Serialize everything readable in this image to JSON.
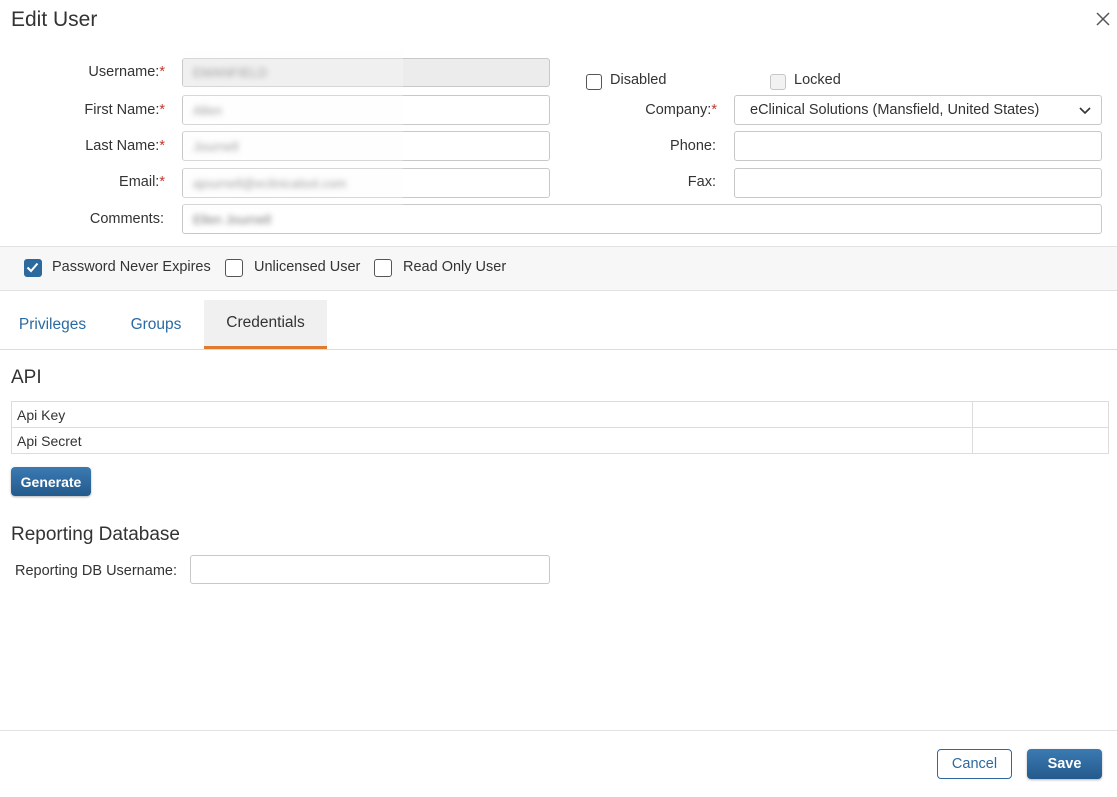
{
  "dialog": {
    "title": "Edit User",
    "close_icon": "close-icon"
  },
  "form": {
    "username": {
      "label": "Username:",
      "required": "*",
      "value": "EMANFIELD"
    },
    "first_name": {
      "label": "First Name:",
      "required": "*",
      "value": "Allen"
    },
    "last_name": {
      "label": "Last Name:",
      "required": "*",
      "value": "Journell"
    },
    "email": {
      "label": "Email:",
      "required": "*",
      "value": "ajournell@eclinicalsol.com"
    },
    "comments": {
      "label": "Comments:",
      "value": "Ellen Journell"
    },
    "disabled": {
      "label": "Disabled",
      "checked": false
    },
    "locked": {
      "label": "Locked",
      "checked": false,
      "disabled": true
    },
    "company": {
      "label": "Company:",
      "required": "*",
      "value": "eClinical Solutions (Mansfield, United States)"
    },
    "phone": {
      "label": "Phone:",
      "value": ""
    },
    "fax": {
      "label": "Fax:",
      "value": ""
    }
  },
  "options": {
    "password_never_expires": {
      "label": "Password Never Expires",
      "checked": true
    },
    "unlicensed_user": {
      "label": "Unlicensed User",
      "checked": false
    },
    "read_only_user": {
      "label": "Read Only User",
      "checked": false
    }
  },
  "tabs": [
    {
      "label": "Privileges",
      "active": false
    },
    {
      "label": "Groups",
      "active": false
    },
    {
      "label": "Credentials",
      "active": true
    }
  ],
  "api": {
    "heading": "API",
    "rows": [
      {
        "label": "Api Key",
        "value": ""
      },
      {
        "label": "Api Secret",
        "value": ""
      }
    ],
    "generate_label": "Generate"
  },
  "reporting": {
    "heading": "Reporting Database",
    "username_label": "Reporting DB Username:",
    "username_value": ""
  },
  "footer": {
    "cancel_label": "Cancel",
    "save_label": "Save"
  },
  "colors": {
    "accent": "#2c6a9e",
    "tab_underline": "#e07a2e",
    "required": "#c0392b"
  }
}
